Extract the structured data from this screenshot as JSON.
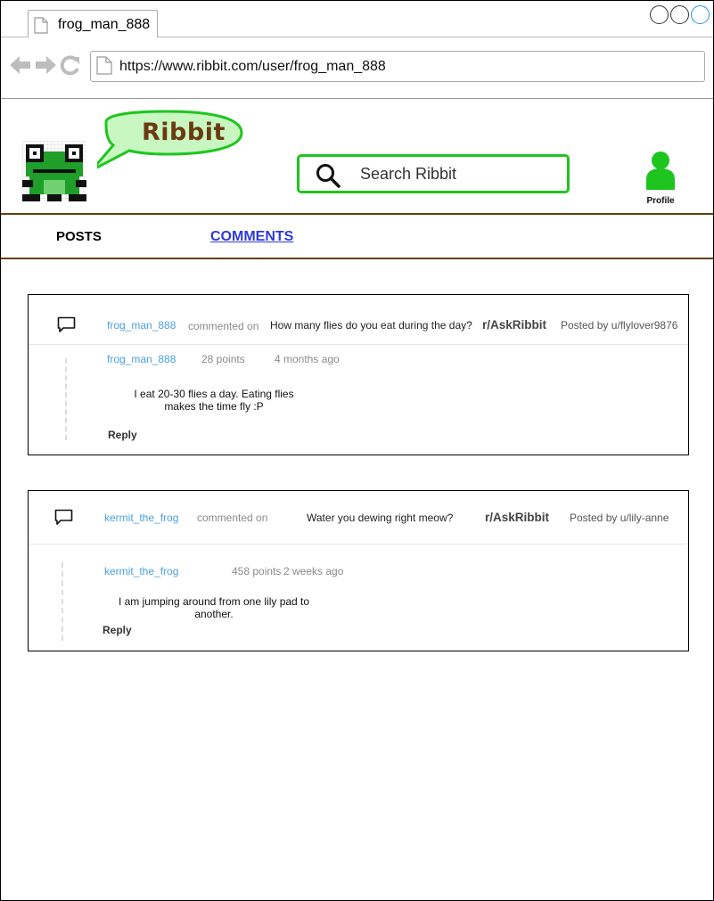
{
  "browser": {
    "tab_title": "frog_man_888",
    "url": "https://www.ribbit.com/user/frog_man_888"
  },
  "site": {
    "brand": "Ribbit",
    "search_placeholder": "Search Ribbit",
    "profile_label": "Profile",
    "accent_color": "#1fc51f",
    "brand_color": "#6b3a10"
  },
  "tabs": {
    "posts": "POSTS",
    "comments": "COMMENTS"
  },
  "comments": [
    {
      "author": "frog_man_888",
      "commented_on_label": "commented on",
      "post_title": "How many flies do you eat during the day?",
      "subreddit": "r/AskRibbit",
      "posted_by": "Posted by u/flylover9876",
      "reply_author": "frog_man_888",
      "points": "28 points",
      "age": "4 months ago",
      "body_line1": "I eat 20-30 flies a day. Eating flies",
      "body_line2": "makes the time fly :P",
      "reply_label": "Reply"
    },
    {
      "author": "kermit_the_frog",
      "commented_on_label": "commented on",
      "post_title": "Water you dewing right meow?",
      "subreddit": "r/AskRibbit",
      "posted_by": "Posted by u/lily-anne",
      "reply_author": "kermit_the_frog",
      "points": "458 points",
      "age": "2 weeks ago",
      "body_line1": "I am jumping around from one lily pad to",
      "body_line2": "another.",
      "reply_label": "Reply"
    }
  ]
}
